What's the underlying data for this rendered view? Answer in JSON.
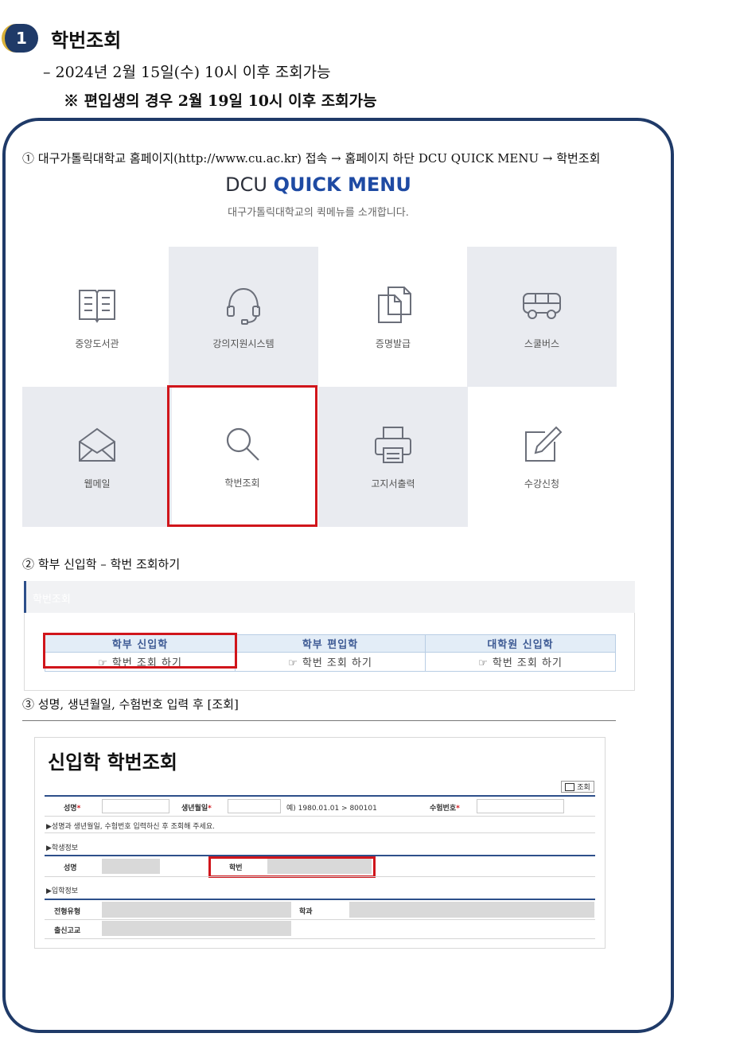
{
  "header": {
    "badge_number": "1",
    "title": "학번조회",
    "line1": "– 2024년 2월 15일(수) 10시 이후 조회가능",
    "line2": "※ 편입생의 경우 2월 19일 10시 이후 조회가능"
  },
  "step1": {
    "text": "① 대구가톨릭대학교 홈페이지(http://www.cu.ac.kr) 접속 → 홈페이지 하단 DCU QUICK MENU → 학번조회",
    "menu_title_prefix": "DCU",
    "menu_title_highlight": "QUICK MENU",
    "menu_subtitle": "대구가톨릭대학교의 퀵메뉴를 소개합니다.",
    "tiles": [
      {
        "label": "중앙도서관",
        "icon": "book-icon"
      },
      {
        "label": "강의지원시스템",
        "icon": "headset-icon"
      },
      {
        "label": "증명발급",
        "icon": "documents-icon"
      },
      {
        "label": "스쿨버스",
        "icon": "bus-icon"
      },
      {
        "label": "웹메일",
        "icon": "mail-icon"
      },
      {
        "label": "학번조회",
        "icon": "search-icon"
      },
      {
        "label": "고지서출력",
        "icon": "printer-icon"
      },
      {
        "label": "수강신청",
        "icon": "edit-icon"
      }
    ]
  },
  "step2": {
    "text": "② 학부 신입학 – 학번 조회하기",
    "panel_heading": "학번조회",
    "columns": [
      "학부 신입학",
      "학부 편입학",
      "대학원 신입학"
    ],
    "link_label": "☞ 학번 조회 하기"
  },
  "step3": {
    "text": "③ 성명, 생년월일, 수험번호 입력 후 [조회]",
    "form_title": "신입학 학번조회",
    "query_button": "조회",
    "name_label": "성명",
    "birth_label": "생년월일",
    "birth_example": "예) 1980.01.01 > 800101",
    "exam_label": "수험번호",
    "required_mark": "*",
    "notice": "▶성명과 생년월일, 수험번호 입력하신 후 조회해 주세요.",
    "section_student": "▶학생정보",
    "student_name_label": "성명",
    "student_id_label": "학번",
    "section_admission": "▶입학정보",
    "admission_type_label": "전형유형",
    "department_label": "학과",
    "school_label": "출신고교"
  },
  "colors": {
    "navy": "#1f3a68",
    "highlight_red": "#d0151b",
    "accent_blue": "#1e4aa3",
    "tile_gray": "#e9ebf0"
  }
}
